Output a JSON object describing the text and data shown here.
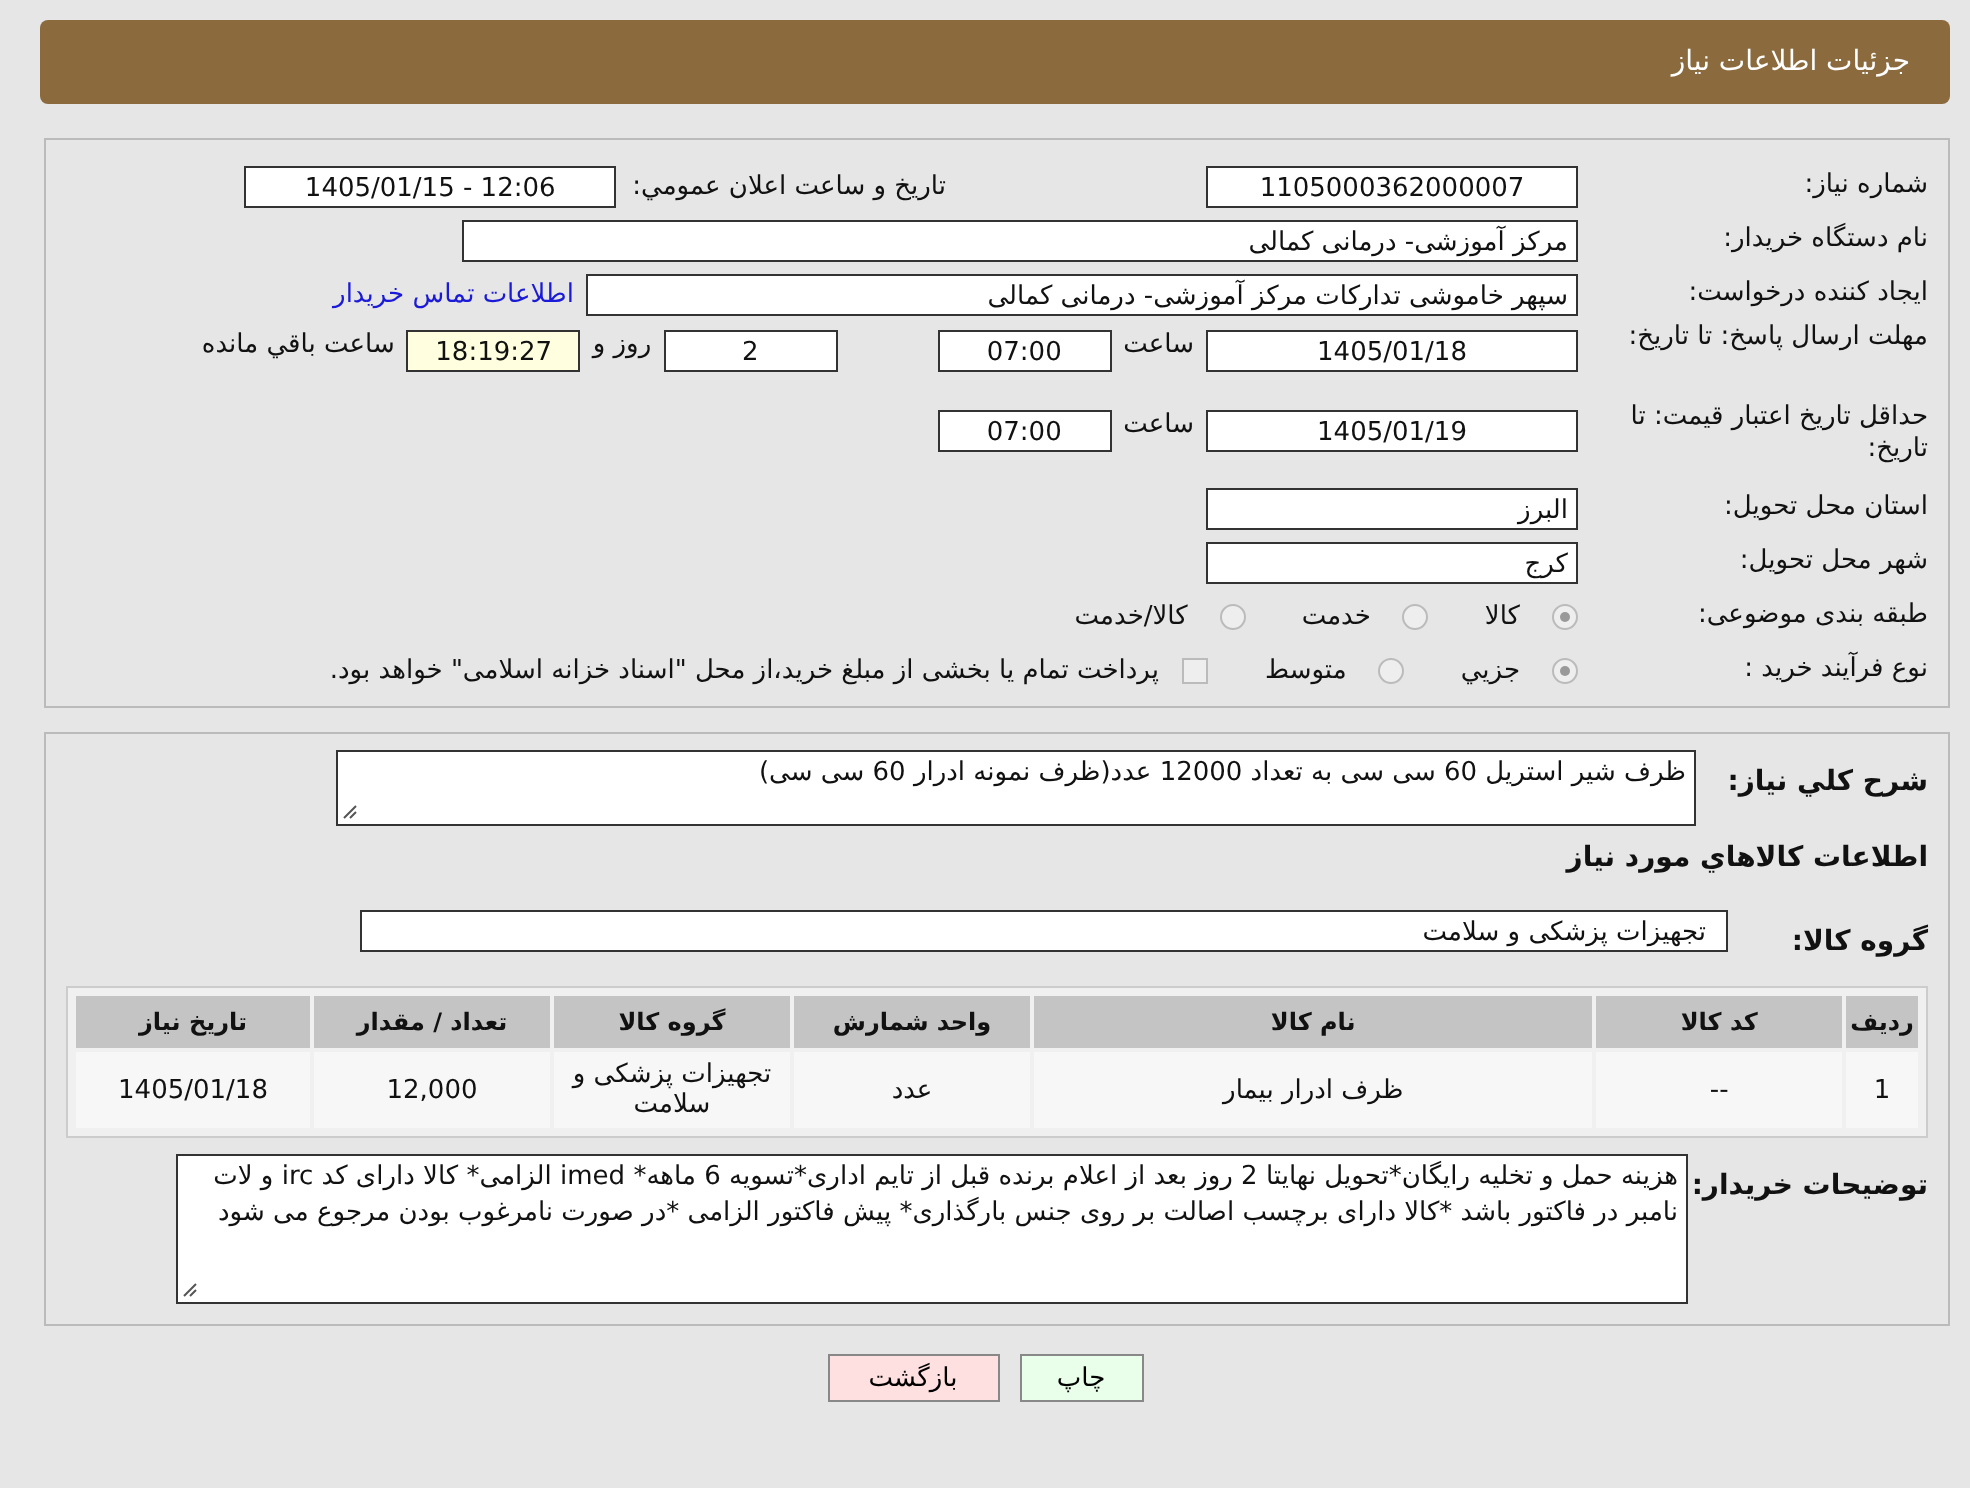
{
  "header": {
    "title": "جزئیات اطلاعات نیاز"
  },
  "need_number": {
    "label": "شماره نیاز:",
    "value": "1105000362000007"
  },
  "announce": {
    "label": "تاریخ و ساعت اعلان عمومي:",
    "value": "1405/01/15 - 12:06"
  },
  "buyer": {
    "label": "نام دستگاه خریدار:",
    "value": "مرکز آموزشی- درمانی کمالی"
  },
  "requester": {
    "label": "ایجاد کننده درخواست:",
    "value": "سپهر خاموشی تدارکات مرکز آموزشی- درمانی کمالی",
    "link": "اطلاعات تماس خریدار"
  },
  "deadline": {
    "label": "مهلت ارسال پاسخ: تا تاریخ:",
    "date": "1405/01/18",
    "time_label": "ساعت",
    "time": "07:00",
    "days": "2",
    "days_label": "روز و",
    "remaining": "18:19:27",
    "remaining_label": "ساعت باقي مانده"
  },
  "validity": {
    "label": "حداقل تاریخ اعتبار قیمت: تا تاریخ:",
    "date": "1405/01/19",
    "time_label": "ساعت",
    "time": "07:00"
  },
  "province": {
    "label": "استان محل تحویل:",
    "value": "البرز"
  },
  "city": {
    "label": "شهر محل تحویل:",
    "value": "کرج"
  },
  "category": {
    "label": "طبقه بندی موضوعی:",
    "options": [
      {
        "label": "کالا",
        "selected": true
      },
      {
        "label": "خدمت",
        "selected": false
      },
      {
        "label": "کالا/خدمت",
        "selected": false
      }
    ]
  },
  "process": {
    "label": "نوع فرآیند خرید :",
    "options": [
      {
        "label": "جزیي",
        "selected": true
      },
      {
        "label": "متوسط",
        "selected": false
      }
    ],
    "payment": {
      "label": "پرداخت تمام یا بخشی از مبلغ خرید،از محل \"اسناد خزانه اسلامی\" خواهد بود.",
      "checked": false
    }
  },
  "description": {
    "label": "شرح کلي نیاز:",
    "value": "ظرف شیر استریل 60 سی سی به تعداد 12000 عدد(ظرف نمونه ادرار 60 سی سی)"
  },
  "goods_heading": "اطلاعات کالاهاي مورد نیاز",
  "goods_group": {
    "label": "گروه کالا:",
    "value": "تجهیزات پزشکی و سلامت"
  },
  "table": {
    "columns": [
      "ردیف",
      "کد کالا",
      "نام کالا",
      "واحد شمارش",
      "گروه کالا",
      "تعداد / مقدار",
      "تاریخ نیاز"
    ],
    "rows": [
      [
        "1",
        "--",
        "ظرف ادرار بیمار",
        "عدد",
        "تجهیزات پزشکی و سلامت",
        "12,000",
        "1405/01/18"
      ]
    ]
  },
  "buyer_notes": {
    "label": "توضیحات خریدار:",
    "value": "هزینه حمل و تخلیه رایگان*تحویل نهایتا 2 روز بعد از اعلام برنده قبل از تایم اداری*تسویه 6 ماهه* imed الزامی* کالا دارای کد irc و لات نامبر در فاکتور باشد *کالا دارای برچسب اصالت بر روی جنس بارگذاری* پیش فاکتور الزامی *در صورت نامرغوب بودن مرجوع می شود"
  },
  "buttons": [
    {
      "label": "چاپ",
      "kind": "print"
    },
    {
      "label": "بازگشت",
      "kind": "back"
    }
  ]
}
